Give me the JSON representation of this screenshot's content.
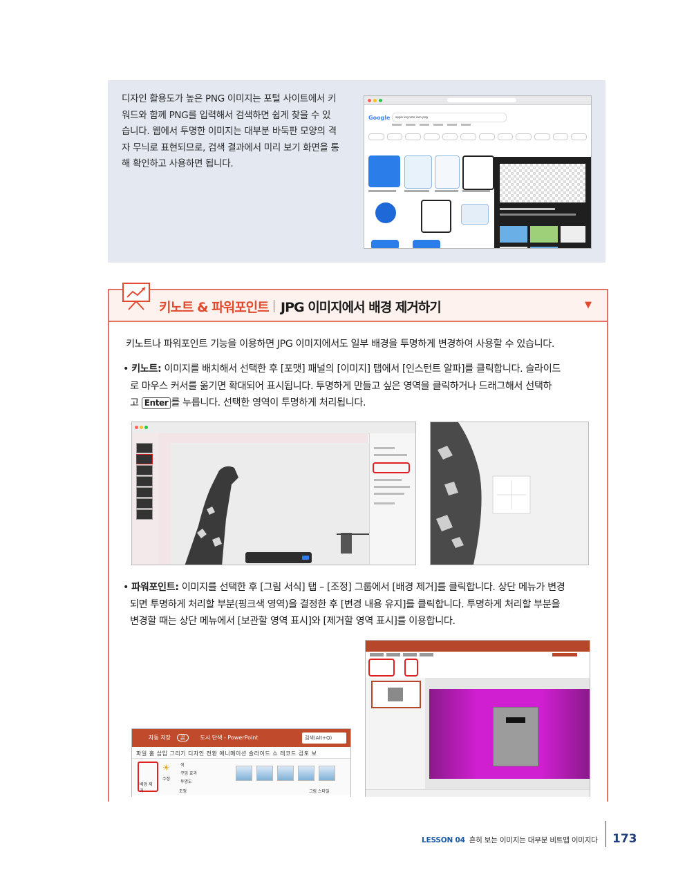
{
  "intro": {
    "lines": [
      "디자인 활용도가 높은 PNG 이미지는 포털 사이트에서 키",
      "워드와 함께 PNG를 입력해서 검색하면 쉽게 찾을 수 있",
      "습니다. 웹에서 투명한 이미지는 대부분 바둑판 모양의 격",
      "자 무늬로 표현되므로, 검색 결과에서 미리 보기 화면을 통",
      "해 확인하고 사용하면 됩니다."
    ],
    "screenshot": {
      "logo": "Google",
      "query": "apple keynote icon png"
    }
  },
  "section": {
    "title_left": "키노트 & 파워포인트",
    "title_right": "JPG 이미지에서 배경 제거하기",
    "toggle_icon": "triangle-down-icon",
    "intro": "키노트나 파워포인트 기능을 이용하면 JPG 이미지에서도 일부 배경을 투명하게 변경하여 사용할 수 있습니다.",
    "keynote": {
      "label": "키노트:",
      "line1": " 이미지를 배치해서 선택한 후 [포맷] 패널의 [이미지] 탭에서 [인스턴트 알파]를 클릭합니다. 슬라이드",
      "line2": "로 마우스 커서를 옮기면 확대되어 표시됩니다. 투명하게 만들고 싶은 영역을 클릭하거나 드래그해서 선택하",
      "line3_pre": "고 ",
      "key": "Enter",
      "line3_post": "를 누릅니다. 선택한 영역이 투명하게 처리됩니다."
    },
    "powerpoint": {
      "label": "파워포인트:",
      "line1": " 이미지를 선택한 후 [그림 서식] 탭 – [조정] 그룹에서 [배경 제거]를 클릭합니다. 상단 메뉴가 변경",
      "line2": "되면 투명하게 처리할 부분(핑크색 영역)을 결정한 후 [변경 내용 유지]를 클릭합니다. 투명하게 처리할 부분을",
      "line3": "변경할 때는 상단 메뉴에서 [보관할 영역 표시]와 [제거할 영역 표시]를 이용합니다."
    },
    "pp_ribbon": {
      "autosave": "자동 저장",
      "toggle": "끔",
      "doc": "도시 단색 - PowerPoint",
      "search": "검색(Alt+Q)",
      "menu": "파일   홈   삽입   그리기   디자인   전환   애니메이션   슬라이드 쇼   레코드   검토   보",
      "remove_bg": "배경 제거",
      "correct": "수정",
      "color": "색",
      "effects": "꾸밈 효과",
      "transparency": "투명도",
      "adjust": "조정",
      "styles": "그림 스타일"
    }
  },
  "footer": {
    "lesson": "LESSON 04",
    "title": "흔히 보는 이미지는 대부분 비트맵 이미지다",
    "page": "173"
  },
  "colors": {
    "accent": "#e2492f",
    "box_bg": "#e3e8f1",
    "lesson_blue": "#1a5aa8",
    "page_blue": "#1f3f7a"
  }
}
